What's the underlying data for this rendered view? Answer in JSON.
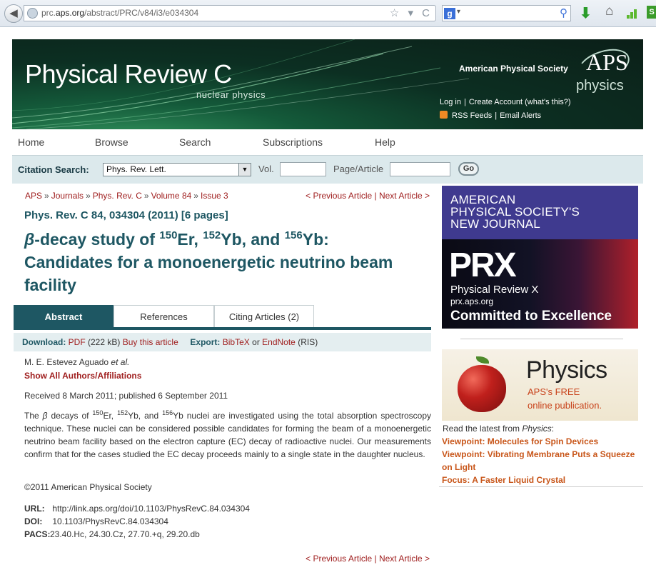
{
  "browser": {
    "url_prefix": "prc.",
    "url_domain": "aps.org",
    "url_path": "/abstract/PRC/v84/i3/e034304",
    "search_engine": "g",
    "url_icons": "☆ ▾ C"
  },
  "banner": {
    "journal_title": "Physical Review C",
    "journal_subtitle": "nuclear physics",
    "society": "American Physical Society",
    "logo_big": "APS",
    "logo_small": "physics",
    "login": "Log in",
    "create_account": "Create Account (what's this?)",
    "rss": "RSS Feeds",
    "email_alerts": "Email Alerts"
  },
  "nav": {
    "items": [
      "Home",
      "Browse",
      "Search",
      "Subscriptions",
      "Help"
    ]
  },
  "citation_search": {
    "label": "Citation Search:",
    "journal": "Phys. Rev. Lett.",
    "vol_label": "Vol.",
    "page_label": "Page/Article",
    "go": "Go"
  },
  "breadcrumb": [
    "APS",
    "Journals",
    "Phys. Rev. C",
    "Volume 84",
    "Issue 3"
  ],
  "breadcrumb_sep": "»",
  "prev_article": "< Previous Article",
  "next_article": "Next Article >",
  "article": {
    "citation": "Phys. Rev. C 84, 034304 (2011) [6 pages]",
    "title_beta": "β",
    "title_1": "-decay study of ",
    "mass1": "150",
    "el1": "Er, ",
    "mass2": "152",
    "el2": "Yb, and ",
    "mass3": "156",
    "el3": "Yb:",
    "title_line2": "Candidates for a monoenergetic neutrino beam facility",
    "tabs": [
      "Abstract",
      "References",
      "Citing Articles (2)"
    ],
    "download_label": "Download:",
    "pdf": "PDF",
    "pdf_size": "(222 kB)",
    "buy": "Buy this article",
    "export_label": "Export:",
    "bibtex": "BibTeX",
    "or": "or",
    "endnote": "EndNote",
    "ris": "(RIS)",
    "authors": "M. E. Estevez Aguado",
    "et_al": "et al.",
    "show_all": "Show All Authors/Affiliations",
    "received": "Received 8 March 2011; published 6 September 2011",
    "abstract_a": "The ",
    "abstract_beta": "β",
    "abstract_b": " decays of ",
    "abstract_c": "Er, ",
    "abstract_d": "Yb, and ",
    "abstract_e": "Yb nuclei are investigated using the total absorption spectroscopy technique. These nuclei can be considered possible candidates for forming the beam of a monoenergetic neutrino beam facility based on the electron capture (EC) decay of radioactive nuclei. Our measurements confirm that for the cases studied the EC decay proceeds mainly to a single state in the daughter nucleus.",
    "copyright": "©2011 American Physical Society",
    "url_key": "URL:",
    "url_val": "http://link.aps.org/doi/10.1103/PhysRevC.84.034304",
    "doi_key": "DOI:",
    "doi_val": "10.1103/PhysRevC.84.034304",
    "pacs_key": "PACS:",
    "pacs_val": "23.40.Hc, 24.30.Cz, 27.70.+q, 29.20.db"
  },
  "sidebar": {
    "prx_line1": "AMERICAN",
    "prx_line2": "PHYSICAL SOCIETY'S",
    "prx_line3": "NEW JOURNAL",
    "prx_logo": "PRX",
    "prx_name": "Physical Review X",
    "prx_url": "prx.aps.org",
    "prx_tagline": "Committed to Excellence",
    "physics_word": "Physics",
    "physics_free": "APS's FREE",
    "physics_pub": "online publication.",
    "latest_pre": "Read the latest from ",
    "latest_italic": "Physics",
    "latest_post": ":",
    "viewpoints": [
      "Viewpoint: Molecules for Spin Devices",
      "Viewpoint: Vibrating Membrane Puts a Squeeze on Light",
      "Focus: A Faster Liquid Crystal"
    ]
  },
  "colors": {
    "teal": "#1e5763",
    "link_red": "#a02020",
    "viewpoint_orange": "#c8561a"
  }
}
